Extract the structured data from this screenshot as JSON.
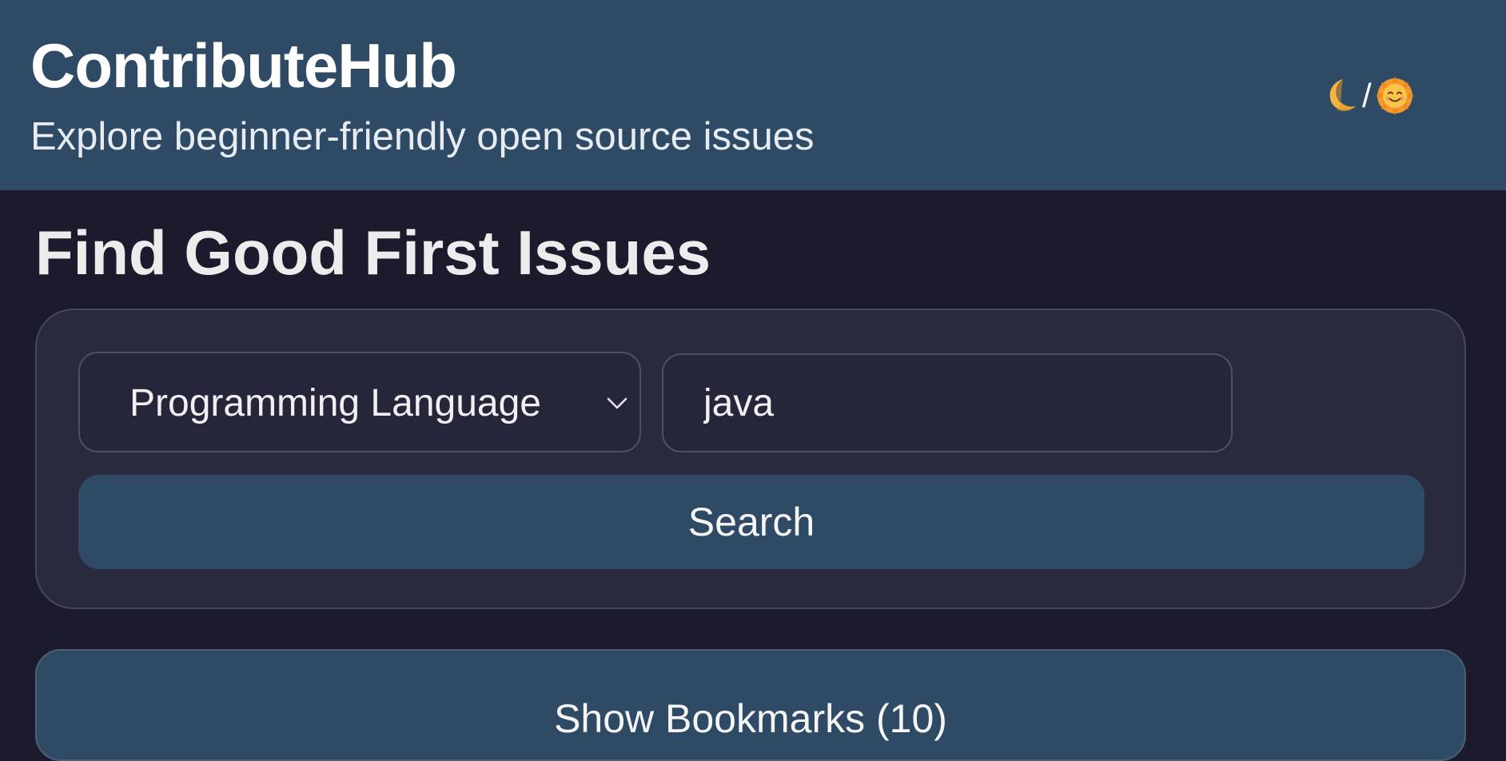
{
  "header": {
    "title": "ContributeHub",
    "subtitle": "Explore beginner-friendly open source issues",
    "theme_toggle": {
      "moon_icon": "crescent-moon-icon",
      "separator": "/",
      "sun_icon": "smiling-sun-icon"
    }
  },
  "main": {
    "heading": "Find Good First Issues",
    "search": {
      "filter_select": {
        "selected": "Programming Language",
        "icon": "chevron-down-icon"
      },
      "query_value": "java",
      "button_label": "Search"
    },
    "bookmarks_button_label": "Show Bookmarks (10)"
  },
  "colors": {
    "header_bg": "#2e4a64",
    "page_bg": "#1b1b2d",
    "card_bg": "#2a2a3e",
    "accent_button": "#2e4a64"
  }
}
